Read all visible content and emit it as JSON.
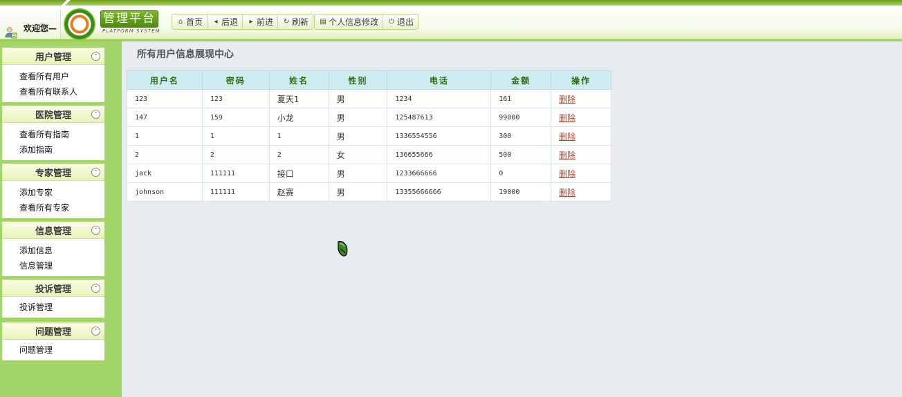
{
  "header": {
    "welcome": "欢迎您—",
    "logo_title": "管理平台",
    "logo_sub": "PLATFORM SYSTEM",
    "nav": [
      {
        "label": "首页",
        "icon": "home-icon"
      },
      {
        "label": "后退",
        "icon": "back-arrow-icon"
      },
      {
        "label": "前进",
        "icon": "forward-arrow-icon"
      },
      {
        "label": "刷新",
        "icon": "refresh-icon"
      }
    ],
    "account": [
      {
        "label": "个人信息修改",
        "icon": "document-icon"
      },
      {
        "label": "退出",
        "icon": "power-icon"
      }
    ]
  },
  "sidebar": {
    "groups": [
      {
        "title": "用户管理",
        "items": [
          "查看所有用户",
          "查看所有联系人"
        ]
      },
      {
        "title": "医院管理",
        "items": [
          "查看所有指南",
          "添加指南"
        ]
      },
      {
        "title": "专家管理",
        "items": [
          "添加专家",
          "查看所有专家"
        ]
      },
      {
        "title": "信息管理",
        "items": [
          "添加信息",
          "信息管理"
        ]
      },
      {
        "title": "投诉管理",
        "items": [
          "投诉管理"
        ]
      },
      {
        "title": "问题管理",
        "items": [
          "问题管理"
        ]
      }
    ]
  },
  "main": {
    "title": "所有用户信息展现中心",
    "table": {
      "headers": [
        "用户名",
        "密码",
        "姓名",
        "性别",
        "电话",
        "金额",
        "操作"
      ],
      "rows": [
        [
          "123",
          "123",
          "夏天1",
          "男",
          "1234",
          "161",
          "删除"
        ],
        [
          "147",
          "159",
          "小龙",
          "男",
          "125487613",
          "99000",
          "删除"
        ],
        [
          "1",
          "1",
          "1",
          "男",
          "1336554556",
          "300",
          "删除"
        ],
        [
          "2",
          "2",
          "2",
          "女",
          "136655666",
          "500",
          "删除"
        ],
        [
          "jack",
          "111111",
          "接口",
          "男",
          "1233666666",
          "0",
          "删除"
        ],
        [
          "johnson",
          "111111",
          "赵赛",
          "男",
          "13355666666",
          "19000",
          "删除"
        ]
      ]
    }
  },
  "colors": {
    "accent_green": "#a2d56a",
    "header_text_green": "#2a6b12",
    "table_header_bg": "#cdebf1",
    "delete_link": "#b5472a"
  }
}
